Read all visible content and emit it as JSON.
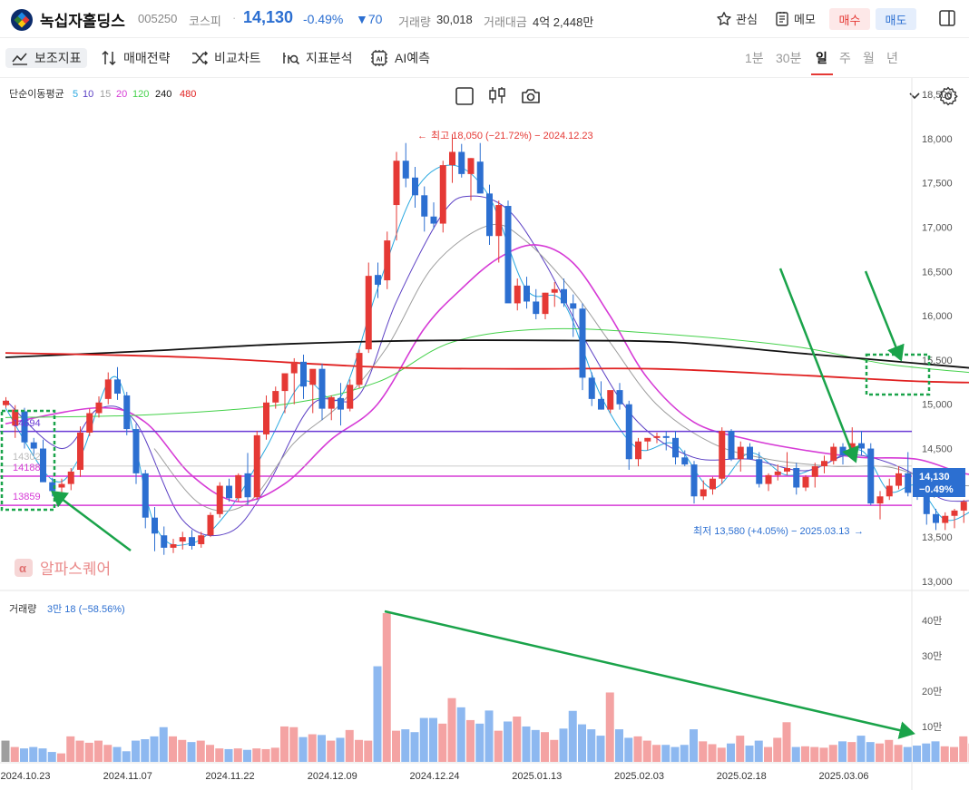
{
  "header": {
    "stock_name": "녹십자홀딩스",
    "stock_code": "005250",
    "market": "코스피",
    "separator": "·",
    "price": "14,130",
    "change_pct": "-0.49%",
    "change_amt": "▼70",
    "volume_label": "거래량",
    "volume_value": "30,018",
    "amount_label": "거래대금",
    "amount_value": "4억 2,448만",
    "watch_label": "관심",
    "memo_label": "메모",
    "buy_label": "매수",
    "sell_label": "매도"
  },
  "toolbar": {
    "indicators_label": "보조지표",
    "strategy_label": "매매전략",
    "compare_label": "비교차트",
    "analysis_label": "지표분석",
    "ai_label": "AI예측",
    "timeframes": [
      "1분",
      "30분",
      "일",
      "주",
      "월",
      "년"
    ],
    "active_timeframe": "일"
  },
  "colors": {
    "up": "#e53935",
    "down": "#2c6fd1",
    "volume_up": "#f4a3a3",
    "volume_down": "#8db8f0",
    "annotation_green": "#1aa34a"
  },
  "chart_data": {
    "type": "candlestick",
    "ma_label": "단순이동평균",
    "ma_periods": [
      {
        "period": "5",
        "color": "#29a8e0"
      },
      {
        "period": "10",
        "color": "#5b3fc4"
      },
      {
        "period": "15",
        "color": "#9e9e9e"
      },
      {
        "period": "20",
        "color": "#d63bd6"
      },
      {
        "period": "120",
        "color": "#44d14a"
      },
      {
        "period": "240",
        "color": "#111111"
      },
      {
        "period": "480",
        "color": "#e02020"
      }
    ],
    "y_ticks": [
      "18,500",
      "18,000",
      "17,500",
      "17,000",
      "16,500",
      "16,000",
      "15,500",
      "15,000",
      "14,500",
      "14,000",
      "13,500",
      "13,000"
    ],
    "y_range": [
      13000,
      18500
    ],
    "x_ticks": [
      "2024.10.23",
      "2024.11.07",
      "2024.11.22",
      "2024.12.09",
      "2024.12.24",
      "2025.01.13",
      "2025.02.03",
      "2025.02.18",
      "2025.03.06"
    ],
    "high_label": "최고 18,050 (−21.72%) − 2024.12.23",
    "low_label": "최저 13,580 (+4.05%) − 2025.03.13",
    "price_tag": "14,130",
    "price_tag_pct": "−0.49%",
    "levels": [
      {
        "label": "14694",
        "value": 14694,
        "color": "#6a3ad6"
      },
      {
        "label": "14302",
        "value": 14302,
        "color": "#bbbbbb"
      },
      {
        "label": "14188",
        "value": 14188,
        "color": "#d63bd6"
      },
      {
        "label": "13859",
        "value": 13859,
        "color": "#d63bd6"
      }
    ],
    "candles": [
      [
        14990,
        15080,
        14960,
        15040
      ],
      [
        14760,
        14990,
        14620,
        14940
      ],
      [
        14920,
        14960,
        14500,
        14570
      ],
      [
        14570,
        14620,
        14420,
        14500
      ],
      [
        14500,
        14600,
        14200,
        14120
      ],
      [
        14120,
        14170,
        13960,
        14020
      ],
      [
        14060,
        14160,
        13940,
        14100
      ],
      [
        14100,
        14280,
        14030,
        14240
      ],
      [
        14260,
        14750,
        14180,
        14680
      ],
      [
        14680,
        14950,
        14640,
        14900
      ],
      [
        14900,
        15090,
        14850,
        15020
      ],
      [
        15060,
        15360,
        15000,
        15280
      ],
      [
        15280,
        15420,
        15050,
        15120
      ],
      [
        15100,
        15140,
        14650,
        14720
      ],
      [
        14720,
        14780,
        14100,
        14220
      ],
      [
        14220,
        14260,
        13600,
        13720
      ],
      [
        13720,
        13840,
        13340,
        13540
      ],
      [
        13520,
        13620,
        13300,
        13380
      ],
      [
        13380,
        13480,
        13320,
        13420
      ],
      [
        13450,
        13560,
        13360,
        13500
      ],
      [
        13500,
        13580,
        13360,
        13400
      ],
      [
        13420,
        13560,
        13380,
        13520
      ],
      [
        13520,
        13780,
        13500,
        13750
      ],
      [
        13760,
        14120,
        13720,
        14080
      ],
      [
        14080,
        14160,
        13900,
        13940
      ],
      [
        13940,
        14220,
        13900,
        14200
      ],
      [
        14220,
        14450,
        13860,
        13950
      ],
      [
        13950,
        14700,
        13920,
        14650
      ],
      [
        14660,
        15100,
        14600,
        15020
      ],
      [
        15020,
        15200,
        14950,
        15150
      ],
      [
        15150,
        15320,
        14900,
        15350
      ],
      [
        15350,
        15520,
        15000,
        15480
      ],
      [
        15480,
        15560,
        15060,
        15200
      ],
      [
        15220,
        15380,
        14900,
        15400
      ],
      [
        15400,
        15460,
        14820,
        14950
      ],
      [
        14950,
        15100,
        14820,
        15080
      ],
      [
        15070,
        15240,
        14760,
        14940
      ],
      [
        14950,
        15280,
        14920,
        15220
      ],
      [
        15220,
        15620,
        15180,
        15580
      ],
      [
        15620,
        16600,
        15580,
        16450
      ],
      [
        16460,
        16600,
        16200,
        16350
      ],
      [
        16400,
        16950,
        16300,
        16850
      ],
      [
        17250,
        17850,
        16850,
        17750
      ],
      [
        17750,
        17950,
        17450,
        17550
      ],
      [
        17560,
        17680,
        17220,
        17360
      ],
      [
        17360,
        17460,
        16950,
        17120
      ],
      [
        17120,
        17280,
        16980,
        17040
      ],
      [
        17040,
        17750,
        16940,
        17700
      ],
      [
        17700,
        18050,
        17500,
        17850
      ],
      [
        17850,
        17940,
        17560,
        17600
      ],
      [
        17600,
        17780,
        17300,
        17780
      ],
      [
        17740,
        17950,
        17440,
        17380
      ],
      [
        17380,
        17480,
        16800,
        16900
      ],
      [
        16900,
        17300,
        16600,
        17250
      ],
      [
        17240,
        17300,
        16240,
        16140
      ],
      [
        16140,
        16420,
        16060,
        16340
      ],
      [
        16340,
        16440,
        16080,
        16160
      ],
      [
        16160,
        16300,
        15960,
        16020
      ],
      [
        16020,
        16260,
        15960,
        16260
      ],
      [
        16260,
        16380,
        16100,
        16300
      ],
      [
        16300,
        16420,
        16100,
        16140
      ],
      [
        16140,
        16240,
        15760,
        16080
      ],
      [
        16080,
        16140,
        15160,
        15300
      ],
      [
        15300,
        15360,
        14980,
        15060
      ],
      [
        15060,
        15260,
        14940,
        14940
      ],
      [
        14940,
        15080,
        14900,
        15160
      ],
      [
        15160,
        15240,
        14940,
        15000
      ],
      [
        15000,
        15040,
        14260,
        14380
      ],
      [
        14380,
        14620,
        14300,
        14580
      ],
      [
        14580,
        14620,
        14480,
        14620
      ],
      [
        14620,
        14680,
        14560,
        14640
      ],
      [
        14640,
        14700,
        14480,
        14620
      ],
      [
        14620,
        14700,
        14320,
        14400
      ],
      [
        14400,
        14480,
        14300,
        14320
      ],
      [
        14320,
        14360,
        13880,
        13960
      ],
      [
        13960,
        14140,
        13920,
        14040
      ],
      [
        14040,
        14180,
        13980,
        14160
      ],
      [
        14160,
        14740,
        14100,
        14700
      ],
      [
        14700,
        14720,
        14360,
        14380
      ],
      [
        14380,
        14580,
        14240,
        14520
      ],
      [
        14520,
        14560,
        14380,
        14380
      ],
      [
        14380,
        14460,
        14060,
        14100
      ],
      [
        14100,
        14220,
        14020,
        14200
      ],
      [
        14200,
        14320,
        14140,
        14240
      ],
      [
        14240,
        14460,
        14200,
        14280
      ],
      [
        14280,
        14340,
        13980,
        14060
      ],
      [
        14060,
        14200,
        14020,
        14180
      ],
      [
        14180,
        14340,
        14060,
        14300
      ],
      [
        14300,
        14420,
        14220,
        14360
      ],
      [
        14360,
        14560,
        14320,
        14520
      ],
      [
        14520,
        14560,
        14320,
        14420
      ],
      [
        14420,
        14740,
        14380,
        14560
      ],
      [
        14560,
        14700,
        14420,
        14500
      ],
      [
        14500,
        14560,
        13860,
        13880
      ],
      [
        13880,
        14020,
        13700,
        13960
      ],
      [
        13960,
        14160,
        13920,
        14080
      ],
      [
        14080,
        14300,
        14040,
        14220
      ],
      [
        14220,
        14460,
        13960,
        14000
      ],
      [
        14000,
        14120,
        13920,
        13980
      ],
      [
        13980,
        14040,
        13640,
        13760
      ],
      [
        13760,
        13820,
        13580,
        13660
      ],
      [
        13660,
        13780,
        13580,
        13740
      ],
      [
        13740,
        13820,
        13600,
        13800
      ],
      [
        13800,
        13920,
        13660,
        13900
      ],
      [
        13900,
        14060,
        13860,
        14000
      ],
      [
        14000,
        14280,
        13960,
        14200
      ],
      [
        14200,
        14280,
        14060,
        14130
      ]
    ],
    "volume_label": "거래량",
    "volume_value": "3만 18 (−58.56%)",
    "volume_ticks": [
      "40만",
      "30만",
      "20만",
      "10만"
    ],
    "volume_range": [
      0,
      420000
    ],
    "volumes": [
      60000,
      42000,
      38000,
      42000,
      38000,
      28000,
      24000,
      72000,
      60000,
      54000,
      60000,
      48000,
      42000,
      30000,
      60000,
      64000,
      72000,
      98000,
      72000,
      62000,
      56000,
      60000,
      48000,
      38000,
      36000,
      38000,
      34000,
      38000,
      36000,
      40000,
      100000,
      98000,
      70000,
      78000,
      76000,
      60000,
      68000,
      90000,
      62000,
      60000,
      270000,
      420000,
      88000,
      92000,
      84000,
      124000,
      124000,
      108000,
      180000,
      154000,
      118000,
      108000,
      145000,
      88000,
      114000,
      128000,
      100000,
      90000,
      84000,
      62000,
      94000,
      144000,
      106000,
      92000,
      74000,
      196000,
      92000,
      68000,
      72000,
      60000,
      48000,
      48000,
      42000,
      48000,
      92000,
      58000,
      50000,
      40000,
      52000,
      74000,
      46000,
      60000,
      42000,
      68000,
      112000,
      42000,
      44000,
      42000,
      40000,
      48000,
      58000,
      56000,
      74000,
      56000,
      52000,
      62000,
      48000,
      42000,
      46000,
      52000,
      58000,
      44000,
      42000,
      72000,
      52000
    ],
    "ma_lines": {
      "ma5": [
        [
          0,
          14960
        ],
        [
          5,
          14150
        ],
        [
          8,
          14400
        ],
        [
          12,
          15300
        ],
        [
          16,
          13650
        ],
        [
          20,
          13430
        ],
        [
          24,
          13800
        ],
        [
          28,
          14500
        ],
        [
          32,
          15250
        ],
        [
          36,
          15080
        ],
        [
          40,
          16300
        ],
        [
          44,
          17400
        ],
        [
          48,
          17700
        ],
        [
          52,
          17350
        ],
        [
          56,
          16300
        ],
        [
          60,
          16150
        ],
        [
          64,
          15100
        ],
        [
          68,
          14500
        ],
        [
          72,
          14550
        ],
        [
          76,
          14050
        ],
        [
          80,
          14450
        ],
        [
          84,
          14200
        ],
        [
          88,
          14320
        ],
        [
          92,
          14480
        ],
        [
          95,
          14020
        ],
        [
          98,
          14080
        ],
        [
          101,
          13700
        ],
        [
          104,
          13800
        ],
        [
          107,
          14000
        ]
      ],
      "ma10": [
        [
          0,
          15050
        ],
        [
          6,
          14500
        ],
        [
          10,
          14950
        ],
        [
          14,
          14800
        ],
        [
          19,
          13700
        ],
        [
          24,
          13550
        ],
        [
          28,
          14050
        ],
        [
          33,
          15000
        ],
        [
          38,
          15100
        ],
        [
          42,
          16150
        ],
        [
          47,
          17150
        ],
        [
          50,
          17350
        ],
        [
          54,
          17200
        ],
        [
          58,
          16600
        ],
        [
          63,
          15600
        ],
        [
          68,
          14800
        ],
        [
          74,
          14400
        ],
        [
          80,
          14380
        ],
        [
          86,
          14250
        ],
        [
          91,
          14430
        ],
        [
          97,
          14250
        ],
        [
          101,
          13920
        ],
        [
          107,
          13960
        ]
      ],
      "ma15": [
        [
          16,
          14500
        ],
        [
          21,
          13870
        ],
        [
          26,
          13880
        ],
        [
          31,
          14560
        ],
        [
          36,
          15000
        ],
        [
          41,
          15640
        ],
        [
          46,
          16560
        ],
        [
          52,
          17020
        ],
        [
          56,
          16840
        ],
        [
          61,
          16280
        ],
        [
          65,
          15700
        ],
        [
          70,
          15000
        ],
        [
          76,
          14560
        ],
        [
          82,
          14380
        ],
        [
          89,
          14300
        ],
        [
          95,
          14290
        ],
        [
          101,
          14100
        ],
        [
          107,
          14080
        ]
      ],
      "ma20": [
        [
          0,
          14780
        ],
        [
          10,
          14960
        ],
        [
          15,
          14800
        ],
        [
          20,
          14200
        ],
        [
          25,
          13900
        ],
        [
          30,
          14100
        ],
        [
          35,
          14600
        ],
        [
          40,
          15000
        ],
        [
          45,
          15850
        ],
        [
          49,
          16300
        ],
        [
          53,
          16650
        ],
        [
          57,
          16800
        ],
        [
          61,
          16600
        ],
        [
          65,
          16000
        ],
        [
          69,
          15300
        ],
        [
          74,
          14800
        ],
        [
          80,
          14600
        ],
        [
          86,
          14480
        ],
        [
          92,
          14400
        ],
        [
          98,
          14380
        ],
        [
          103,
          14220
        ],
        [
          107,
          14180
        ]
      ],
      "ma120": [
        [
          0,
          14850
        ],
        [
          15,
          14880
        ],
        [
          30,
          15000
        ],
        [
          40,
          15250
        ],
        [
          48,
          15700
        ],
        [
          58,
          15850
        ],
        [
          70,
          15800
        ],
        [
          85,
          15650
        ],
        [
          95,
          15450
        ],
        [
          107,
          15330
        ]
      ],
      "ma240": [
        [
          0,
          15530
        ],
        [
          15,
          15600
        ],
        [
          30,
          15680
        ],
        [
          45,
          15720
        ],
        [
          60,
          15720
        ],
        [
          72,
          15700
        ],
        [
          85,
          15580
        ],
        [
          95,
          15490
        ],
        [
          107,
          15380
        ]
      ],
      "ma480": [
        [
          0,
          15580
        ],
        [
          20,
          15530
        ],
        [
          40,
          15420
        ],
        [
          55,
          15400
        ],
        [
          70,
          15400
        ],
        [
          85,
          15330
        ],
        [
          98,
          15260
        ],
        [
          107,
          15240
        ]
      ]
    },
    "watermark": "알파스퀘어"
  }
}
